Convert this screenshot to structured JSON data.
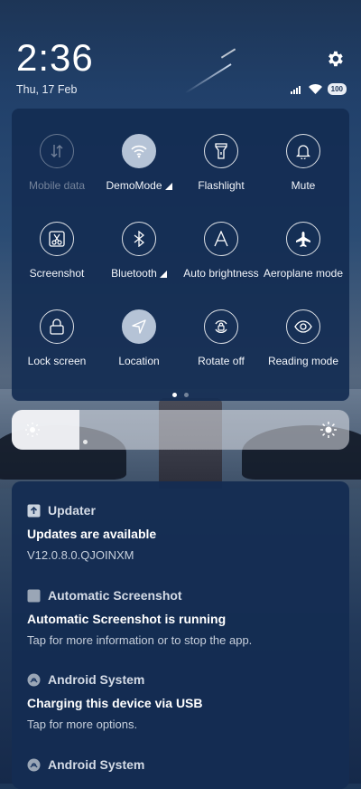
{
  "status": {
    "time": "2:36",
    "date": "Thu, 17 Feb",
    "battery": "100"
  },
  "quick_settings": {
    "tiles": [
      {
        "label": "Mobile data",
        "icon": "mobile-data-icon",
        "state": "disabled"
      },
      {
        "label": "DemoMode",
        "icon": "wifi-icon",
        "state": "active",
        "has_signal": true
      },
      {
        "label": "Flashlight",
        "icon": "flashlight-icon",
        "state": "off"
      },
      {
        "label": "Mute",
        "icon": "bell-icon",
        "state": "off"
      },
      {
        "label": "Screenshot",
        "icon": "scissors-icon",
        "state": "off"
      },
      {
        "label": "Bluetooth",
        "icon": "bluetooth-icon",
        "state": "off",
        "has_signal": true
      },
      {
        "label": "Auto brightness",
        "icon": "auto-brightness-icon",
        "state": "off"
      },
      {
        "label": "Aeroplane mode",
        "icon": "airplane-icon",
        "state": "off"
      },
      {
        "label": "Lock screen",
        "icon": "lock-icon",
        "state": "off"
      },
      {
        "label": "Location",
        "icon": "location-icon",
        "state": "active"
      },
      {
        "label": "Rotate off",
        "icon": "rotate-lock-icon",
        "state": "off"
      },
      {
        "label": "Reading mode",
        "icon": "eye-icon",
        "state": "off"
      }
    ],
    "page_count": 2,
    "current_page": 1
  },
  "brightness": {
    "level": 0.2
  },
  "notifications": [
    {
      "app": "Updater",
      "icon": "updater-icon",
      "title": "Updates are available",
      "text": "V12.0.8.0.QJOINXM"
    },
    {
      "app": "Automatic Screenshot",
      "icon": "app-square-icon",
      "title": "Automatic Screenshot is running",
      "text": "Tap for more information or to stop the app."
    },
    {
      "app": "Android System",
      "icon": "android-system-icon",
      "title": "Charging this device via USB",
      "text": "Tap for more options."
    },
    {
      "app": "Android System",
      "icon": "android-system-icon",
      "title": "",
      "text": ""
    }
  ]
}
